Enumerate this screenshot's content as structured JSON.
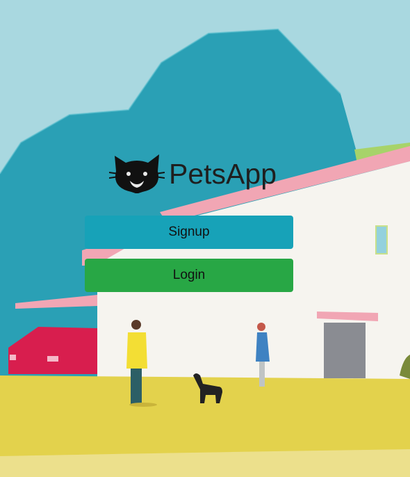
{
  "brand": {
    "name": "PetsApp",
    "logo_icon": "cat-face-icon"
  },
  "buttons": {
    "signup_label": "Signup",
    "login_label": "Login"
  },
  "colors": {
    "signup": "#17a2b8",
    "login": "#28a745",
    "sky": "#a9d8e0",
    "mountain": "#2aa0b5",
    "ground": "#e3d24c"
  }
}
